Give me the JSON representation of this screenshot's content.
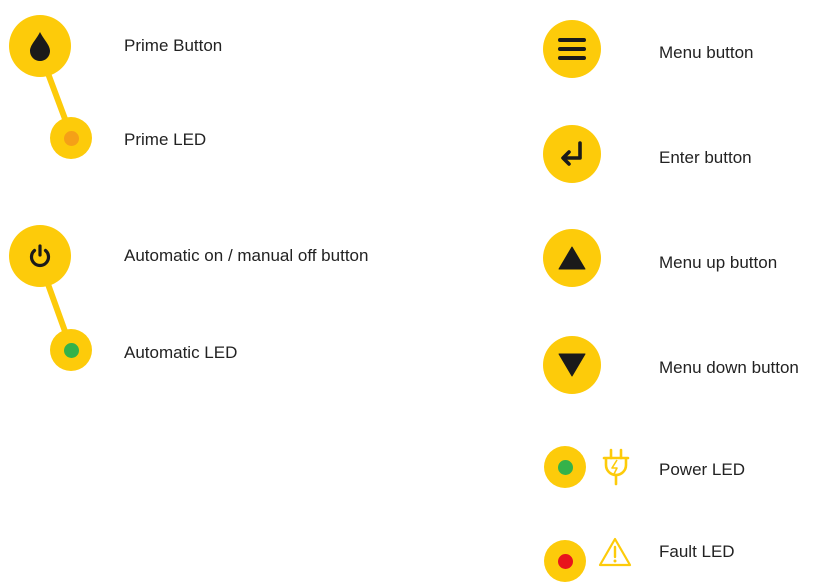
{
  "colors": {
    "yellow": "#FDCB0A",
    "icon_dark": "#1a1a1a",
    "led_orange": "#F5A017",
    "led_green": "#34B24A",
    "led_red": "#E8141C",
    "text": "#222222"
  },
  "left_panel": {
    "prime_button": {
      "label": "Prime Button",
      "icon": "water-drop-icon"
    },
    "prime_led": {
      "label": "Prime LED",
      "led_color": "orange"
    },
    "auto_button": {
      "label": "Automatic on / manual off button",
      "icon": "power-icon"
    },
    "auto_led": {
      "label": "Automatic LED",
      "led_color": "green"
    }
  },
  "right_panel": {
    "menu_button": {
      "label": "Menu button",
      "icon": "hamburger-menu-icon"
    },
    "enter_button": {
      "label": "Enter button",
      "icon": "enter-return-icon"
    },
    "up_button": {
      "label": "Menu up button",
      "icon": "triangle-up-icon"
    },
    "down_button": {
      "label": "Menu down button",
      "icon": "triangle-down-icon"
    },
    "power_led": {
      "label": "Power LED",
      "led_color": "green",
      "symbol": "power-plug-icon"
    },
    "fault_led": {
      "label": "Fault LED",
      "led_color": "red",
      "symbol": "warning-triangle-icon"
    }
  }
}
